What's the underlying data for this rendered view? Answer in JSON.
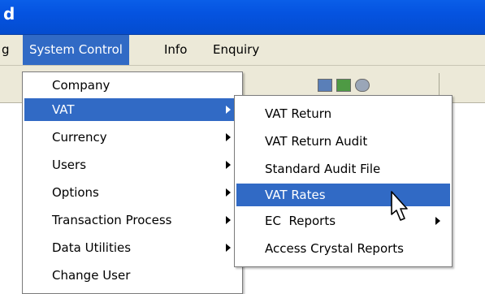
{
  "window": {
    "title_fragment": "d"
  },
  "menubar": {
    "items": [
      {
        "label": "g"
      },
      {
        "label": "System Control"
      },
      {
        "label": "Info"
      },
      {
        "label": "Enquiry"
      }
    ]
  },
  "system_control_menu": {
    "items": [
      {
        "label": "Company",
        "submenu": false
      },
      {
        "label": "VAT",
        "submenu": true,
        "highlighted": true
      },
      {
        "label": "Currency",
        "submenu": true
      },
      {
        "label": "Users",
        "submenu": true
      },
      {
        "label": "Options",
        "submenu": true
      },
      {
        "label": "Transaction Process",
        "submenu": true
      },
      {
        "label": "Data Utilities",
        "submenu": true
      },
      {
        "label": "Change User",
        "submenu": false
      }
    ]
  },
  "vat_submenu": {
    "items": [
      {
        "label": "VAT Return",
        "submenu": false
      },
      {
        "label": "VAT Return Audit",
        "submenu": false
      },
      {
        "label": "Standard Audit File",
        "submenu": false
      },
      {
        "label": "VAT Rates",
        "submenu": false,
        "highlighted": true
      },
      {
        "label": "EC  Reports",
        "submenu": true
      },
      {
        "label": "Access Crystal Reports",
        "submenu": false
      }
    ]
  },
  "colors": {
    "titlebar": "#0553e0",
    "menu_highlight": "#316ac5",
    "chrome": "#ece9d8"
  }
}
